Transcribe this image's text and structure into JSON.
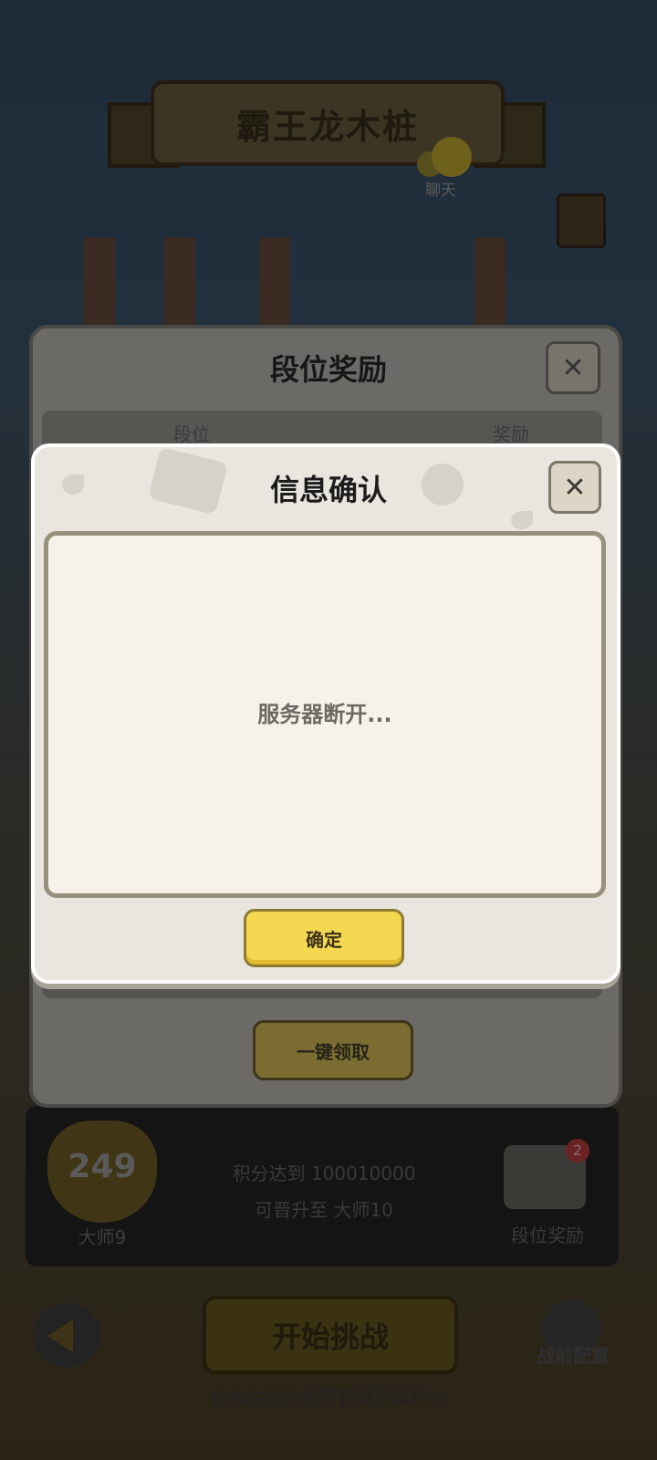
{
  "background": {
    "stage_title": "霸王龙木桩",
    "chat_label": "聊天",
    "rank": {
      "score": "249",
      "name": "大师9",
      "progress_line1": "积分达到 100010000",
      "progress_line2": "可晋升至 大师10"
    },
    "reward": {
      "badge_count": "2",
      "label": "段位奖励"
    },
    "start_label": "开始挑战",
    "config_label": "战前配置",
    "tip_text": "击败主线技能可获得更高积分"
  },
  "rank_reward_panel": {
    "title": "段位奖励",
    "close_glyph": "✕",
    "columns": [
      "段位",
      "奖励"
    ],
    "claim_all_label": "一键领取"
  },
  "confirm_dialog": {
    "title": "信息确认",
    "close_glyph": "✕",
    "message": "服务器断开...",
    "confirm_label": "确定"
  },
  "colors": {
    "dialog_bg": "#e9e5df",
    "content_bg": "#f6f1e9",
    "confirm_button": "#f4d852",
    "title_text": "#1c1c1c"
  },
  "icons": {
    "close": "close-icon",
    "back": "back-arrow-icon",
    "chat": "chat-face-icon",
    "reward": "treasure-chest-icon",
    "config": "character-avatar-icon"
  }
}
